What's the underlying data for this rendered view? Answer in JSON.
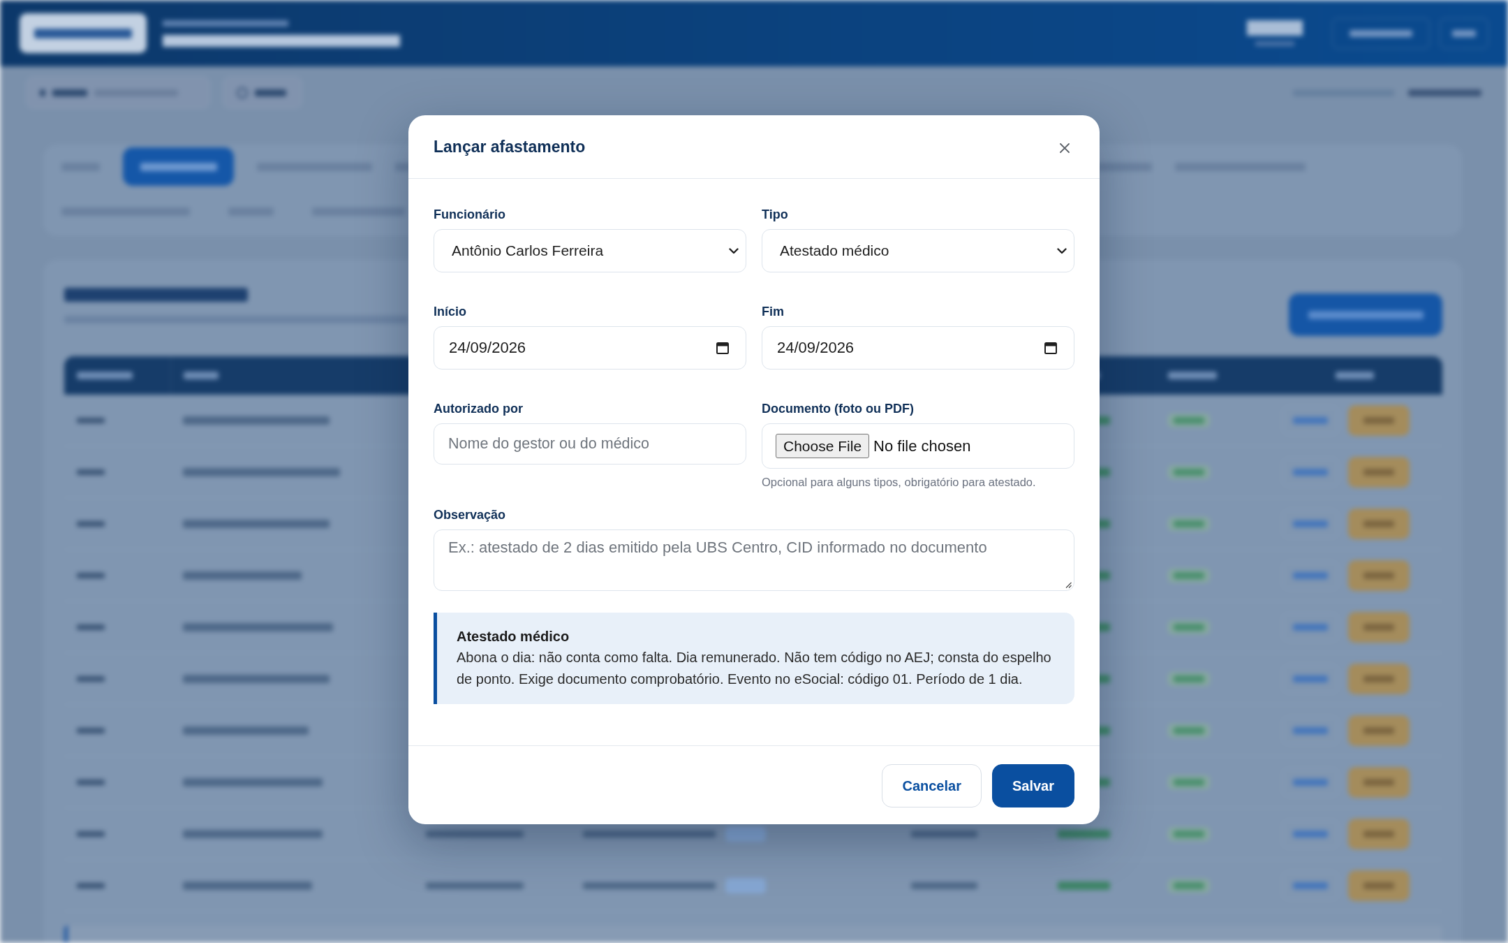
{
  "dialog": {
    "title": "Lançar afastamento"
  },
  "fields": [
    {
      "kind": "select",
      "label": "Funcionário",
      "value": "Antônio Carlos Ferreira"
    },
    {
      "kind": "select",
      "label": "Tipo",
      "value": "Atestado médico"
    },
    {
      "kind": "date",
      "label": "Início",
      "value": "24/09/2026"
    },
    {
      "kind": "date",
      "label": "Fim",
      "value": "24/09/2026"
    },
    {
      "kind": "text",
      "label": "Autorizado por",
      "placeholder": "Nome do gestor ou do médico"
    },
    {
      "kind": "file",
      "label": "Documento (foto ou PDF)",
      "button": "Choose File",
      "status": "No file chosen",
      "hint": "Opcional para alguns tipos, obrigatório para atestado."
    },
    {
      "kind": "textarea",
      "label": "Observação",
      "placeholder": "Ex.: atestado de 2 dias emitido pela UBS Centro, CID informado no documento"
    }
  ],
  "info": {
    "title": "Atestado médico",
    "text": "Abona o dia: não conta como falta. Dia remunerado. Não tem código no AEJ; consta do espelho de ponto. Exige documento comprobatório. Evento no eSocial: código 01. Período de 1 dia."
  },
  "buttons": [
    {
      "kind": "secondary",
      "label": "Cancelar"
    },
    {
      "kind": "primary",
      "label": "Salvar"
    }
  ]
}
